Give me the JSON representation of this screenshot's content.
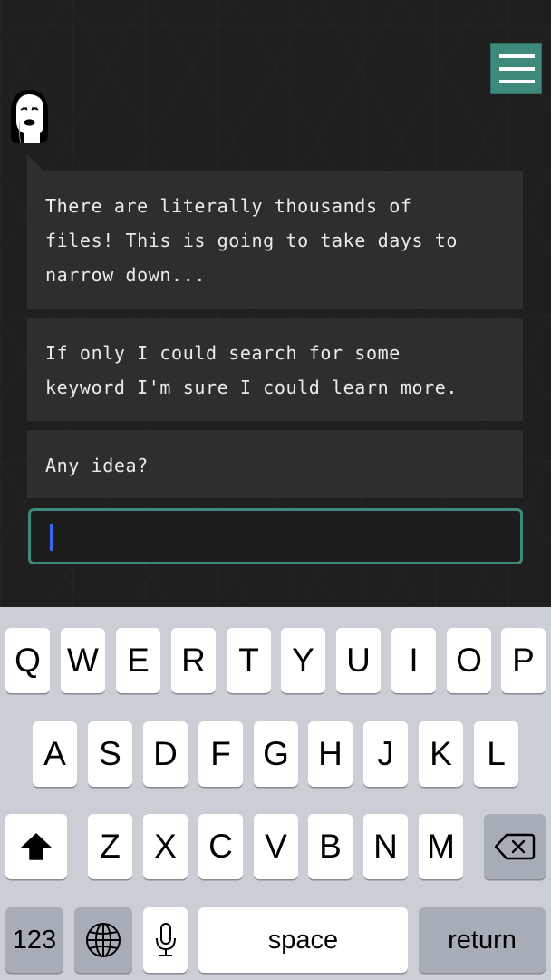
{
  "chat": {
    "menu_button": {
      "icon": "hamburger-menu-icon"
    },
    "avatar": {
      "icon": "female-avatar-icon"
    },
    "messages": [
      {
        "text": "There are literally thousands of\nfiles! This is going to take days to\nnarrow down..."
      },
      {
        "text": "If only I could search for some\nkeyword I'm sure I could learn more."
      },
      {
        "text": "Any idea?"
      }
    ],
    "input": {
      "value": "",
      "placeholder": ""
    }
  },
  "colors": {
    "accent": "#3d8a7a",
    "background": "#1f1f1f",
    "bubble": "#2e2e2e",
    "caret": "#3b66ee",
    "keyboard": "#cbced4"
  },
  "keyboard": {
    "row1": [
      "Q",
      "W",
      "E",
      "R",
      "T",
      "Y",
      "U",
      "I",
      "O",
      "P"
    ],
    "row2": [
      "A",
      "S",
      "D",
      "F",
      "G",
      "H",
      "J",
      "K",
      "L"
    ],
    "row3": [
      "Z",
      "X",
      "C",
      "V",
      "B",
      "N",
      "M"
    ],
    "shift_icon": "shift-arrow-icon",
    "delete_icon": "backspace-icon",
    "numbers_label": "123",
    "globe_icon": "globe-icon",
    "mic_icon": "microphone-icon",
    "space_label": "space",
    "return_label": "return"
  }
}
